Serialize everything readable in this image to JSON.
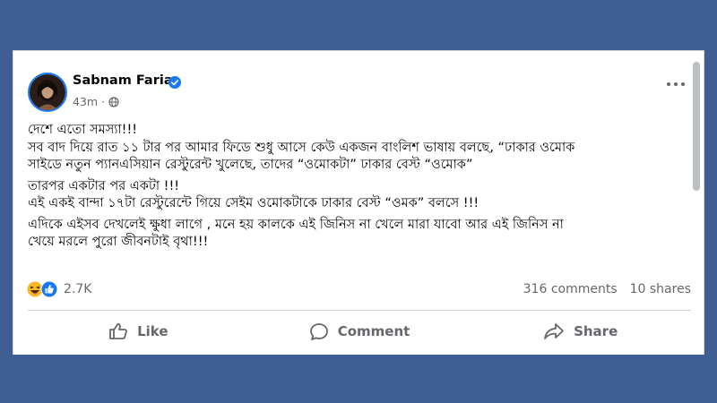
{
  "post": {
    "author_name": "Sabnam Faria",
    "verified_badge": "verified-icon",
    "time": "43m",
    "separator": "·",
    "audience_icon": "globe-icon",
    "body_lines": [
      "দেশে এতো সমস্যা!!!",
      "সব বাদ দিয়ে রাত ১১ টার পর আমার ফিডে শুধু আসে কেউ একজন বাংলিশ ভাষায় বলছে,  “ঢাকার ওমোক",
      "সাইডে নতুন প্যানএসিয়ান রেস্টুরেন্ট খুলেছে, তাদের “ওমোকটা” ঢাকার বেস্ট “ওমোক”",
      "তারপর একটার পর একটা !!!",
      "এই একই বান্দা ১৭টা রেস্টুরেন্টে গিয়ে সেইম ওমোকটাকে ঢাকার বেস্ট “ওমক” বলসে !!!",
      "এদিকে এইসব দেখলেই ক্ষুধা লাগে , মনে হয় কালকে এই জিনিস না খেলে মারা যাবো আর এই জিনিস না",
      "খেয়ে মরলে পুরো জীবনটাই বৃথা!!!"
    ]
  },
  "reactions": {
    "icons": [
      "haha-icon",
      "like-reaction-icon"
    ],
    "count": "2.7K",
    "comments": "316 comments",
    "shares": "10 shares"
  },
  "actions": {
    "like_label": "Like",
    "comment_label": "Comment",
    "share_label": "Share"
  },
  "colors": {
    "frame": "#3f5f94",
    "accent": "#1877f2",
    "secondary_text": "#65676b"
  }
}
